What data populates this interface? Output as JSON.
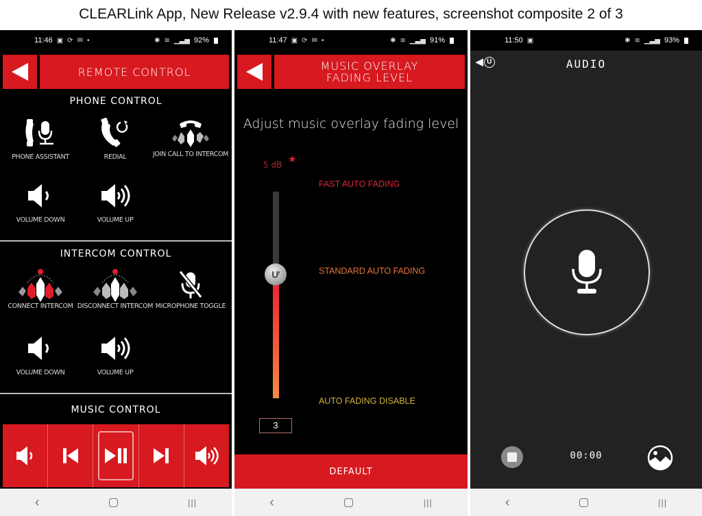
{
  "caption": "CLEARLink App, New Release v2.9.4 with new features, screenshot composite 2 of 3",
  "colors": {
    "brand_red": "#d71920",
    "fast_auto_fading": "#d32a36",
    "standard_auto_fading": "#e8743c",
    "auto_fading_disable": "#d4b13a",
    "db_label": "#a82a30",
    "audio_bg": "#222222"
  },
  "screens": [
    {
      "status": {
        "time": "11:46",
        "left_icons": [
          "gallery-icon",
          "sync-icon",
          "mail-icon",
          "dot-icon"
        ],
        "right_icons": [
          "bluetooth-icon",
          "wifi-icon",
          "signal-icon"
        ],
        "battery": "92%"
      },
      "header": {
        "back_icon": "triangle-left-icon",
        "title": "REMOTE CONTROL"
      },
      "sections": [
        {
          "title": "PHONE CONTROL",
          "controls": [
            {
              "label": "PHONE ASSISTANT",
              "icon": "phone-mic-icon"
            },
            {
              "label": "REDIAL",
              "icon": "phone-redial-icon"
            },
            {
              "label": "JOIN CALL TO INTERCOM",
              "icon": "join-call-intercom-icon"
            },
            {
              "label": "VOLUME DOWN",
              "icon": "volume-down-icon"
            },
            {
              "label": "VOLUME UP",
              "icon": "volume-up-icon"
            }
          ]
        },
        {
          "title": "INTERCOM CONTROL",
          "controls": [
            {
              "label": "CONNECT INTERCOM",
              "icon": "connect-intercom-icon"
            },
            {
              "label": "DISCONNECT INTERCOM",
              "icon": "disconnect-intercom-icon"
            },
            {
              "label": "MICROPHONE TOGGLE",
              "icon": "mic-off-icon"
            },
            {
              "label": "VOLUME DOWN",
              "icon": "volume-down-icon"
            },
            {
              "label": "VOLUME UP",
              "icon": "volume-up-icon"
            }
          ]
        },
        {
          "title": "MUSIC CONTROL",
          "buttons": [
            {
              "icon": "volume-down-icon"
            },
            {
              "icon": "previous-track-icon"
            },
            {
              "icon": "play-pause-icon",
              "active": true
            },
            {
              "icon": "next-track-icon"
            },
            {
              "icon": "volume-up-icon"
            }
          ]
        }
      ]
    },
    {
      "status": {
        "time": "11:47",
        "left_icons": [
          "gallery-icon",
          "sync-icon",
          "mail-icon",
          "dot-icon"
        ],
        "right_icons": [
          "bluetooth-icon",
          "wifi-icon",
          "signal-icon"
        ],
        "battery": "91%"
      },
      "header": {
        "back_icon": "triangle-left-icon",
        "title_line1": "MUSIC OVERLAY",
        "title_line2": "FADING LEVEL"
      },
      "instruction": "Adjust music overlay fading level",
      "slider": {
        "max_label": "5 dB",
        "max_marker": "★",
        "value": 3,
        "min": 0,
        "max": 5,
        "level_labels": [
          "FAST AUTO FADING",
          "STANDARD AUTO FADING",
          "AUTO FADING DISABLE"
        ]
      },
      "default_button": "DEFAULT"
    },
    {
      "status": {
        "time": "11:50",
        "left_icons": [
          "gallery-icon"
        ],
        "right_icons": [
          "bluetooth-icon",
          "wifi-icon",
          "signal-icon"
        ],
        "battery": "93%"
      },
      "header": {
        "back_icon": "back-logo-icon",
        "title": "AUDIO"
      },
      "record_icon": "microphone-icon",
      "timer": "00:00",
      "stop_icon": "stop-icon",
      "gallery_icon": "gallery-icon"
    }
  ],
  "nav": {
    "back": "‹",
    "home": "",
    "recents": "|||"
  }
}
